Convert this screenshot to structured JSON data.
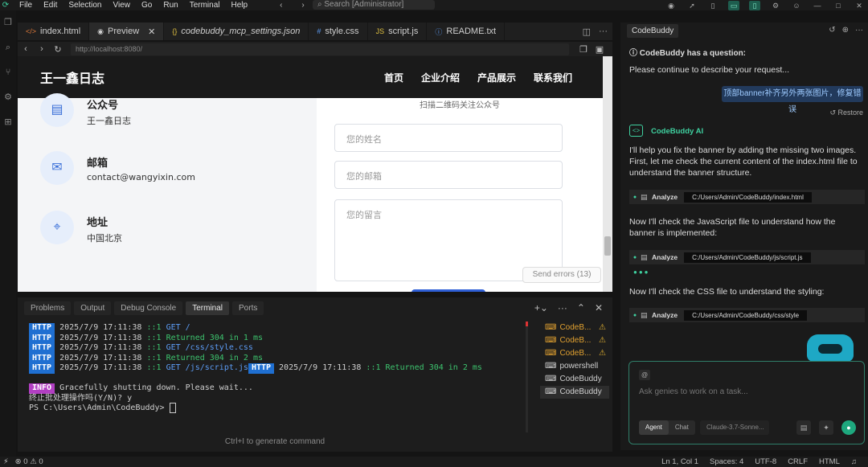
{
  "menubar": {
    "items": [
      "File",
      "Edit",
      "Selection",
      "View",
      "Go",
      "Run",
      "Terminal",
      "Help"
    ],
    "search_placeholder": "Search [Administrator]"
  },
  "editor": {
    "tabs": [
      {
        "icon": "</>",
        "label": "index.html"
      },
      {
        "icon": "◉",
        "label": "Preview",
        "close": "✕"
      },
      {
        "icon": "{}",
        "label": "codebuddy_mcp_settings.json"
      },
      {
        "icon": "#",
        "label": "style.css"
      },
      {
        "icon": "JS",
        "label": "script.js"
      },
      {
        "icon": "ⓘ",
        "label": "README.txt"
      }
    ],
    "url_value": "http://localhost:8080/"
  },
  "site": {
    "title": "王一鑫日志",
    "nav": [
      "首页",
      "企业介绍",
      "产品展示",
      "联系我们"
    ],
    "contacts": [
      {
        "label": "公众号",
        "value": "王一鑫日志"
      },
      {
        "label": "邮箱",
        "value": "contact@wangyixin.com"
      },
      {
        "label": "地址",
        "value": "中国北京"
      }
    ],
    "qr_caption": "扫描二维码关注公众号",
    "form": {
      "name_placeholder": "您的姓名",
      "email_placeholder": "您的邮箱",
      "message_placeholder": "您的留言"
    },
    "send_errors": "Send errors (13)"
  },
  "panel": {
    "tabs": [
      "Problems",
      "Output",
      "Debug Console",
      "Terminal",
      "Ports"
    ],
    "terminal_lines": [
      {
        "badge": "HTTP",
        "ts": "2025/7/9 17:11:38",
        "addr": "::1",
        "msg": "GET /",
        "color": "blue"
      },
      {
        "badge": "HTTP",
        "ts": "2025/7/9 17:11:38",
        "addr": "::1",
        "msg": "Returned 304 in 1 ms",
        "color": "green"
      },
      {
        "badge": "HTTP",
        "ts": "2025/7/9 17:11:38",
        "addr": "::1",
        "msg": "GET /css/style.css",
        "color": "blue"
      },
      {
        "badge": "HTTP",
        "ts": "2025/7/9 17:11:38",
        "addr": "::1",
        "msg": "Returned 304 in 2 ms",
        "color": "green"
      },
      {
        "badge": "HTTP",
        "ts": "2025/7/9 17:11:38",
        "addr": "::1",
        "msg": "GET /js/script.js",
        "color": "blue",
        "extra": {
          "badge": "HTTP",
          "ts": "2025/7/9 17:11:38",
          "addr": "::1",
          "msg": "Returned 304 in 2 ms"
        }
      }
    ],
    "info_badge": "INFO",
    "info_msg": "Gracefully shutting down. Please wait...",
    "prompt_line": "终止批处理操作吗(Y/N)? y",
    "ps_line": "PS C:\\Users\\Admin\\CodeBuddy> ",
    "hint": "Ctrl+I to generate command",
    "terminals": [
      {
        "label": "CodeB...",
        "warn": true
      },
      {
        "label": "CodeB...",
        "warn": true
      },
      {
        "label": "CodeB...",
        "warn": true
      },
      {
        "label": "powershell",
        "warn": false
      },
      {
        "label": "CodeBuddy",
        "warn": false
      },
      {
        "label": "CodeBuddy",
        "warn": false,
        "selected": true
      }
    ]
  },
  "statusbar": {
    "problems": "⊗ 0 ⚠ 0",
    "position": "Ln 1, Col 1",
    "spaces": "Spaces: 4",
    "encoding": "UTF-8",
    "eol": "CRLF",
    "language": "HTML"
  },
  "chat": {
    "tab": "CodeBuddy",
    "question_title": "CodeBuddy has a question:",
    "question_body": "Please continue to describe your request...",
    "user_message": "顶部banner补齐另外两张图片，修复错误",
    "restore": "Restore",
    "ai_name": "CodeBuddy AI",
    "ai_msg1": "I'll help you fix the banner by adding the missing two images. First, let me check the current content of the index.html file to understand the banner structure.",
    "tool1": {
      "name": "Analyze",
      "path": "C:/Users/Admin/CodeBuddy/index.html"
    },
    "ai_msg2": "Now I'll check the JavaScript file to understand how the banner is implemented:",
    "tool2": {
      "name": "Analyze",
      "path": "C:/Users/Admin/CodeBuddy/js/script.js"
    },
    "ai_msg3": "Now I'll check the CSS file to understand the styling:",
    "tool3": {
      "name": "Analyze",
      "path": "C:/Users/Admin/CodeBuddy/css/style"
    },
    "input_placeholder": "Ask genies to work on a task...",
    "mode_agent": "Agent",
    "mode_chat": "Chat",
    "model": "Claude-3.7-Sonne..."
  },
  "colors": {
    "accent": "#3fd1a0",
    "http_badge": "#1f6fd1",
    "info_badge": "#b23fc2"
  }
}
